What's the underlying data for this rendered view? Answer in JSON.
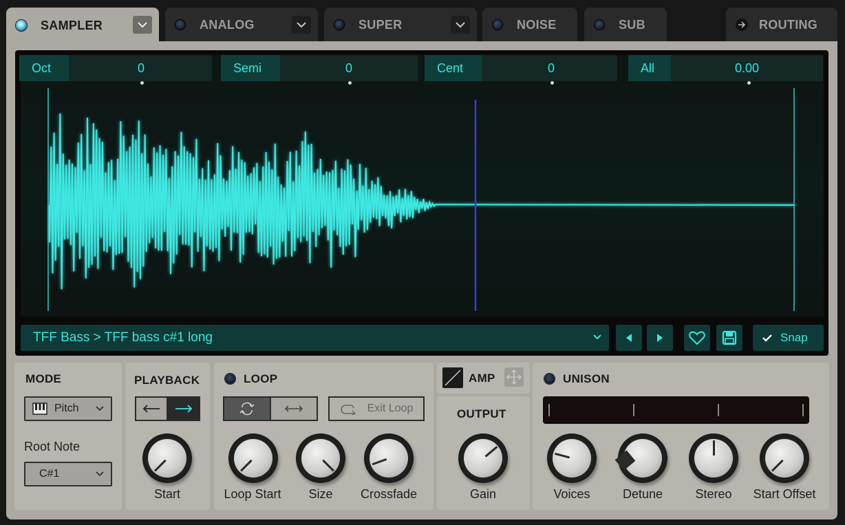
{
  "tabs": [
    {
      "label": "SAMPLER",
      "active": true,
      "has_dropdown": true
    },
    {
      "label": "ANALOG",
      "active": false,
      "has_dropdown": true
    },
    {
      "label": "SUPER",
      "active": false,
      "has_dropdown": true
    },
    {
      "label": "NOISE",
      "active": false,
      "has_dropdown": false
    },
    {
      "label": "SUB",
      "active": false,
      "has_dropdown": false
    },
    {
      "label": "ROUTING",
      "active": false,
      "has_dropdown": false
    }
  ],
  "pitch_params": [
    {
      "label": "Oct",
      "value": "0"
    },
    {
      "label": "Semi",
      "value": "0"
    },
    {
      "label": "Cent",
      "value": "0"
    },
    {
      "label": "All",
      "value": "0.00"
    }
  ],
  "preset": {
    "path": "TFF Bass > TFF bass c#1 long",
    "snap_label": "Snap",
    "snap_checked": true
  },
  "mode": {
    "title": "MODE",
    "value": "Pitch",
    "root_note_label": "Root Note",
    "root_note_value": "C#1"
  },
  "playback": {
    "title": "PLAYBACK",
    "direction": "forward",
    "knob_label": "Start"
  },
  "loop": {
    "title": "LOOP",
    "exit_label": "Exit Loop",
    "knobs": [
      "Loop Start",
      "Size",
      "Crossfade"
    ]
  },
  "amp": {
    "title": "AMP"
  },
  "output": {
    "title": "OUTPUT",
    "knob_label": "Gain"
  },
  "unison": {
    "title": "UNISON",
    "knobs": [
      "Voices",
      "Detune",
      "Stereo",
      "Start Offset"
    ]
  },
  "colors": {
    "accent": "#33e6e0",
    "panel": "#aba9a2",
    "wave": "#3fe8e2",
    "playhead": "#3a3cd6"
  },
  "icons": {
    "tab_dropdown": "chevron-down-icon",
    "routing": "arrow-right-icon",
    "favorite": "heart-icon",
    "save": "floppy-disk-icon",
    "snap": "check-icon",
    "mode": "piano-keys-icon",
    "loop_forward": "loop-cycle-icon",
    "loop_pingpong": "double-arrow-icon",
    "exit_loop": "exit-loop-icon",
    "amp_move": "move-icon"
  }
}
